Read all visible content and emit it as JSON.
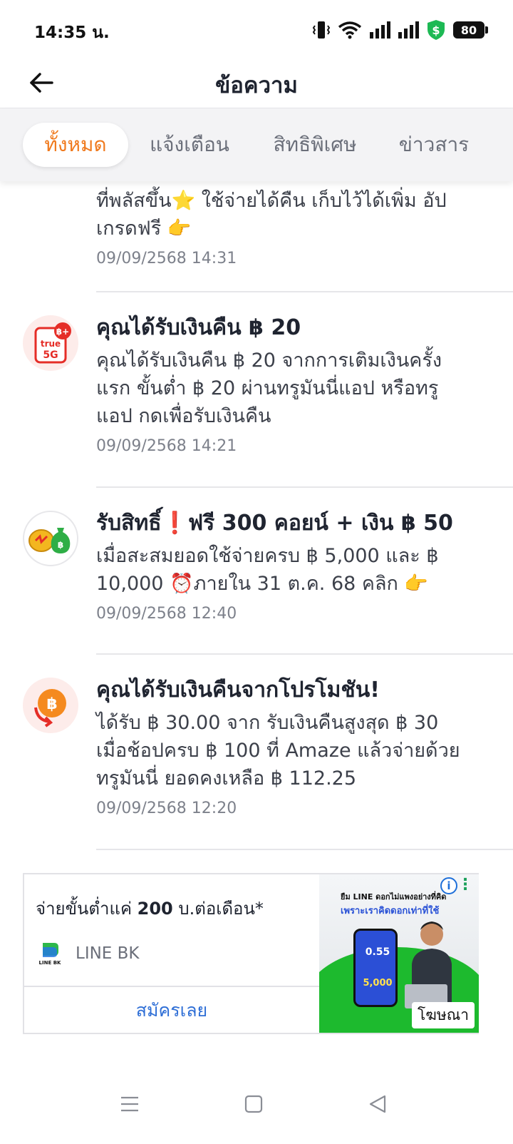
{
  "status_bar": {
    "time": "14:35 น.",
    "battery": "80",
    "icons": [
      "vibrate-icon",
      "wifi-icon",
      "signal-icon",
      "signal-icon",
      "shield-dollar-icon",
      "battery-icon"
    ]
  },
  "header": {
    "title": "ข้อความ",
    "back_icon": "arrow-left-icon"
  },
  "tabs": [
    {
      "label": "ทั้งหมด",
      "active": true
    },
    {
      "label": "แจ้งเตือน",
      "active": false
    },
    {
      "label": "สิทธิพิเศษ",
      "active": false
    },
    {
      "label": "ข่าวสาร",
      "active": false
    }
  ],
  "messages": [
    {
      "text_lines": [
        "ที่พลัสขึ้น⭐ ใช้จ่ายได้คืน เก็บไว้ได้เพิ่ม อัป",
        "เกรดฟรี 👉"
      ],
      "date": "09/09/2568 14:31"
    },
    {
      "icon": "truemoney-5g-icon",
      "icon_text": "true",
      "icon_badge": "฿+",
      "title": "คุณได้รับเงินคืน ฿ 20",
      "text_lines": [
        "คุณได้รับเงินคืน ฿ 20 จากการเติมเงินครั้ง",
        "แรก ขั้นต่ำ ฿ 20 ผ่านทรูมันนี่แอป หรือทรู",
        "แอป กดเพื่อรับเงินคืน"
      ],
      "date": "09/09/2568 14:21"
    },
    {
      "icon": "coins-moneybag-icon",
      "title": "รับสิทธิ์❗ฟรี 300 คอยน์ + เงิน ฿ 50",
      "text_lines": [
        "เมื่อสะสมยอดใช้จ่ายครบ ฿ 5,000 และ ฿",
        "10,000 ⏰ภายใน 31 ต.ค. 68 คลิก 👉"
      ],
      "date": "09/09/2568 12:40"
    },
    {
      "icon": "baht-cashback-icon",
      "title": "คุณได้รับเงินคืนจากโปรโมชัน!",
      "text_lines": [
        "ได้รับ ฿ 30.00 จาก รับเงินคืนสูงสุด ฿ 30",
        "เมื่อช้อปครบ ฿ 100  ที่ Amaze แล้วจ่ายด้วย",
        "ทรูมันนี่ ยอดคงเหลือ ฿ 112.25"
      ],
      "date": "09/09/2568 12:20"
    }
  ],
  "ad": {
    "text_prefix": "จ่ายขั้นต่ำแค่ ",
    "text_bold": "200",
    "text_suffix": " บ.ต่อเดือน*",
    "brand_name": "LINE BK",
    "brand_logo_text": "LINE BK",
    "cta": "สมัครเลย",
    "image_headline1": "ยืม LINE ดอกไม่แพงอย่างที่คิด",
    "image_headline2": "เพราะเราคิดดอกเท่าที่ใช้",
    "image_rate": "0.55",
    "image_amount": "5,000",
    "info_icon": "info-icon",
    "more_icon": "more-vertical-icon",
    "badge": "โฆษณา"
  },
  "nav": {
    "icons": [
      "menu-icon",
      "home-square-icon",
      "back-triangle-icon"
    ]
  },
  "colors": {
    "accent": "#f07a1e",
    "link": "#2f6fd6",
    "text": "#1f2430",
    "muted": "#7d818b"
  }
}
